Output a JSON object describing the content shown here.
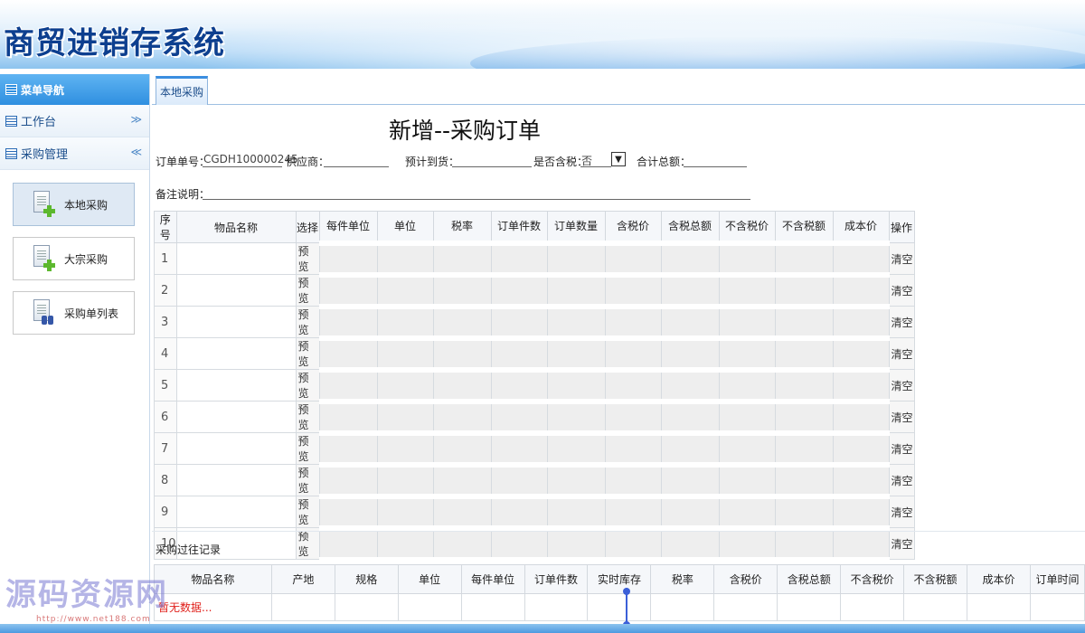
{
  "app": {
    "title": "商贸进销存系统"
  },
  "sidebar": {
    "header": "菜单导航",
    "groups": [
      {
        "label": "工作台",
        "chevron": "≫"
      },
      {
        "label": "采购管理",
        "chevron": "≪"
      }
    ],
    "items": [
      {
        "label": "本地采购",
        "icon": "document-add-icon"
      },
      {
        "label": "大宗采购",
        "icon": "document-add-icon"
      },
      {
        "label": "采购单列表",
        "icon": "document-search-icon"
      }
    ]
  },
  "tabs": [
    {
      "label": "本地采购"
    }
  ],
  "form": {
    "title": "新增--采购订单",
    "order_no_label": "订单单号：",
    "order_no_value": "CGDH100000245",
    "supplier_label": "供应商：",
    "eta_label": "预计到货：",
    "tax_label": "是否含税：",
    "tax_value": "否",
    "total_label": "合计总额：",
    "remark_label": "备注说明："
  },
  "order_table": {
    "headers": [
      "序号",
      "物品名称",
      "选择",
      "每件单位",
      "单位",
      "税率",
      "订单件数",
      "订单数量",
      "含税价",
      "含税总额",
      "不含税价",
      "不含税额",
      "成本价",
      "操作"
    ],
    "preview_label": "预览",
    "clear_label": "清空",
    "rows": [
      "1",
      "2",
      "3",
      "4",
      "5",
      "6",
      "7",
      "8",
      "9",
      "10"
    ]
  },
  "history": {
    "title": "采购过往记录",
    "headers": [
      "物品名称",
      "产地",
      "规格",
      "单位",
      "每件单位",
      "订单件数",
      "实时库存",
      "税率",
      "含税价",
      "含税总额",
      "不含税价",
      "不含税额",
      "成本价",
      "订单时间"
    ],
    "empty_text": "暂无数据..."
  },
  "watermark": {
    "text": "源码资源网",
    "url": "http://www.net188.com"
  }
}
